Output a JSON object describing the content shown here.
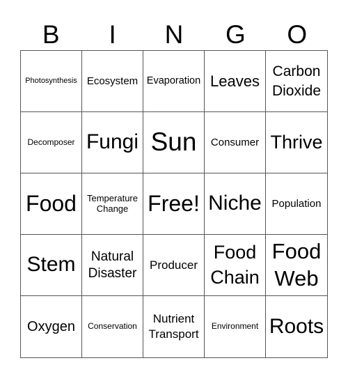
{
  "header": {
    "letters": [
      "B",
      "I",
      "N",
      "G",
      "O"
    ]
  },
  "board": {
    "cells": [
      {
        "text": "Photosynthesis",
        "size": "xs"
      },
      {
        "text": "Ecosystem",
        "size": "s"
      },
      {
        "text": "Evaporation",
        "size": "s"
      },
      {
        "text": "Leaves",
        "size": "m"
      },
      {
        "text": "Carbon Dioxide",
        "size": "m"
      },
      {
        "text": "Decomposer",
        "size": "xs"
      },
      {
        "text": "Fungi",
        "size": "l"
      },
      {
        "text": "Sun",
        "size": "xl"
      },
      {
        "text": "Consumer",
        "size": "s"
      },
      {
        "text": "Thrive",
        "size": "l"
      },
      {
        "text": "Food",
        "size": "xl"
      },
      {
        "text": "Temperature Change",
        "size": "xs"
      },
      {
        "text": "Free!",
        "size": "xl",
        "free": true
      },
      {
        "text": "Niche",
        "size": "l"
      },
      {
        "text": "Population",
        "size": "s"
      },
      {
        "text": "Stem",
        "size": "l"
      },
      {
        "text": "Natural Disaster",
        "size": "m"
      },
      {
        "text": "Producer",
        "size": "s"
      },
      {
        "text": "Food Chain",
        "size": "l"
      },
      {
        "text": "Food Web",
        "size": "l"
      },
      {
        "text": "Oxygen",
        "size": "m"
      },
      {
        "text": "Conservation",
        "size": "xs"
      },
      {
        "text": "Nutrient Transport",
        "size": "s"
      },
      {
        "text": "Environment",
        "size": "xs"
      },
      {
        "text": "Roots",
        "size": "l"
      }
    ]
  }
}
